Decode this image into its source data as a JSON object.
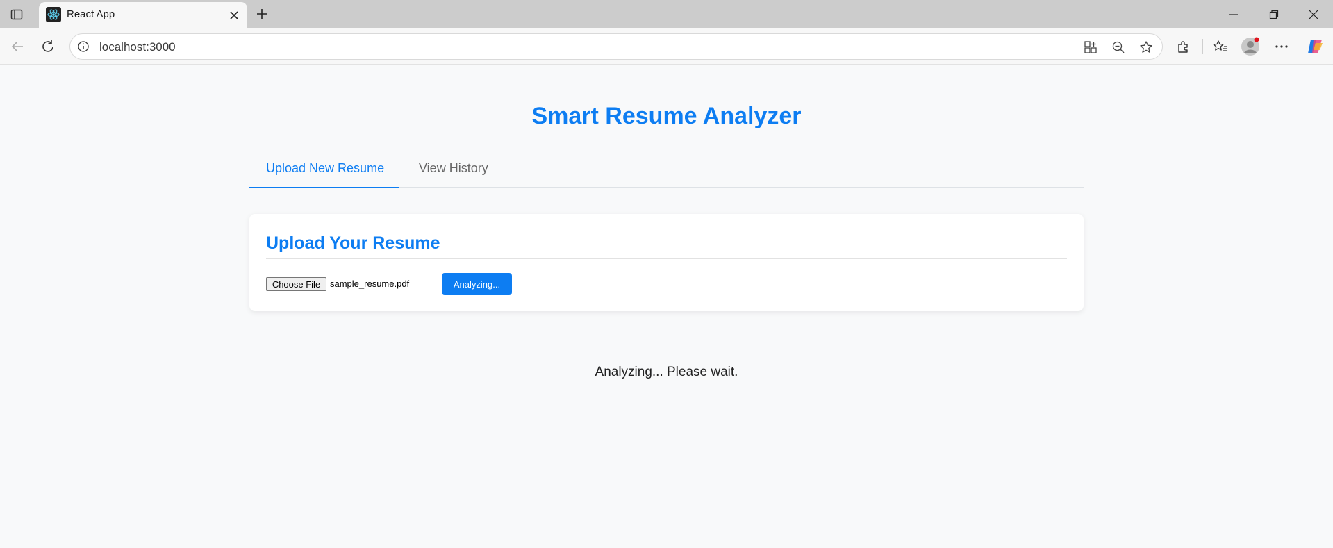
{
  "browser": {
    "tab_title": "React App",
    "url": "localhost:3000"
  },
  "app": {
    "title": "Smart Resume Analyzer",
    "tabs": [
      {
        "label": "Upload New Resume",
        "active": true
      },
      {
        "label": "View History",
        "active": false
      }
    ]
  },
  "upload": {
    "heading": "Upload Your Resume",
    "choose_file_label": "Choose File",
    "file_name": "sample_resume.pdf",
    "button_label": "Analyzing..."
  },
  "status": {
    "message": "Analyzing... Please wait."
  },
  "colors": {
    "accent": "#0d7df2",
    "page_bg": "#f8f9fa"
  },
  "icons": [
    "sidebar-toggle-icon",
    "react-logo-icon",
    "close-icon",
    "plus-icon",
    "minimize-icon",
    "restore-icon",
    "back-icon",
    "refresh-icon",
    "info-icon",
    "app-install-icon",
    "zoom-out-icon",
    "star-icon",
    "extensions-icon",
    "favorites-icon",
    "profile-avatar-icon",
    "more-icon",
    "copilot-icon"
  ]
}
